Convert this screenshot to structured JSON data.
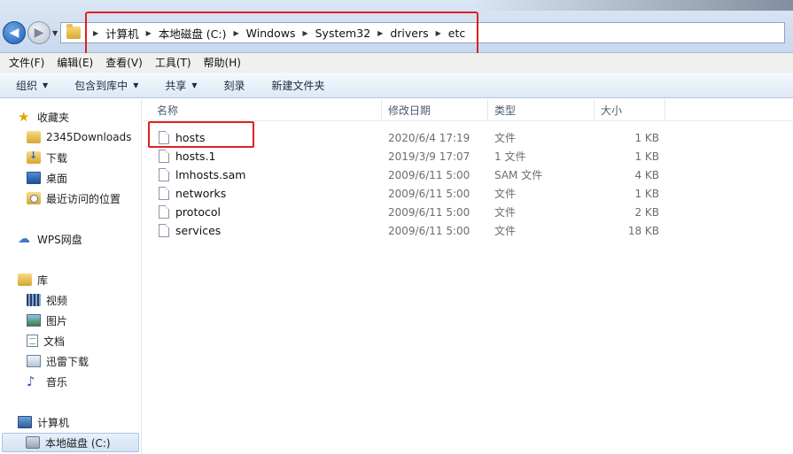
{
  "breadcrumbs": [
    "计算机",
    "本地磁盘 (C:)",
    "Windows",
    "System32",
    "drivers",
    "etc"
  ],
  "menu": [
    "文件(F)",
    "编辑(E)",
    "查看(V)",
    "工具(T)",
    "帮助(H)"
  ],
  "toolbar": {
    "organize": "组织",
    "include_library": "包含到库中",
    "share": "共享",
    "burn": "刻录",
    "new_folder": "新建文件夹"
  },
  "nav": {
    "favorites": "收藏夹",
    "fav_items": [
      "2345Downloads",
      "下载",
      "桌面",
      "最近访问的位置"
    ],
    "wps": "WPS网盘",
    "libraries": "库",
    "lib_items": [
      "视频",
      "图片",
      "文档",
      "迅雷下载",
      "音乐"
    ],
    "computer": "计算机",
    "drive": "本地磁盘 (C:)"
  },
  "columns": {
    "name": "名称",
    "modified": "修改日期",
    "type": "类型",
    "size": "大小"
  },
  "files": [
    {
      "name": "hosts",
      "modified": "2020/6/4 17:19",
      "type": "文件",
      "size": "1 KB"
    },
    {
      "name": "hosts.1",
      "modified": "2019/3/9 17:07",
      "type": "1 文件",
      "size": "1 KB"
    },
    {
      "name": "lmhosts.sam",
      "modified": "2009/6/11 5:00",
      "type": "SAM 文件",
      "size": "4 KB"
    },
    {
      "name": "networks",
      "modified": "2009/6/11 5:00",
      "type": "文件",
      "size": "1 KB"
    },
    {
      "name": "protocol",
      "modified": "2009/6/11 5:00",
      "type": "文件",
      "size": "2 KB"
    },
    {
      "name": "services",
      "modified": "2009/6/11 5:00",
      "type": "文件",
      "size": "18 KB"
    }
  ],
  "colors": {
    "highlight": "#e02020",
    "selection": "#d4e2f4"
  }
}
